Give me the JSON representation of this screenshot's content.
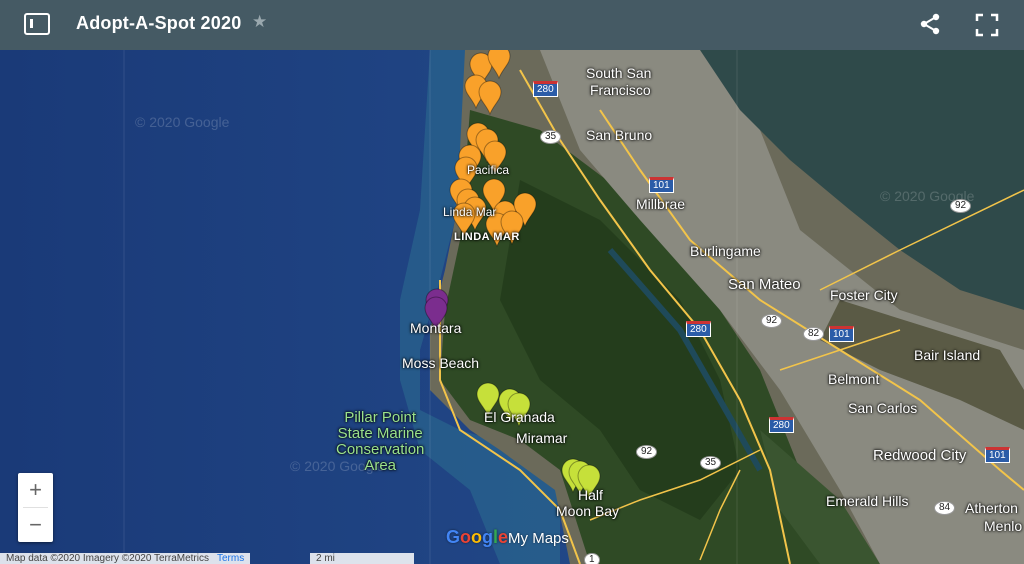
{
  "header": {
    "title": "Adopt-A-Spot 2020",
    "star_icon": "star-icon",
    "share_icon": "share-icon",
    "fullscreen_icon": "fullscreen-icon",
    "menu_icon": "sidebar-toggle-icon"
  },
  "map": {
    "places": [
      {
        "text": "South San",
        "key": "south_san"
      },
      {
        "text": "Francisco",
        "key": "francisco"
      },
      {
        "text": "San Bruno",
        "key": "san_bruno"
      },
      {
        "text": "Millbrae",
        "key": "millbrae"
      },
      {
        "text": "Burlingame",
        "key": "burlingame"
      },
      {
        "text": "San Mateo",
        "key": "san_mateo"
      },
      {
        "text": "Foster City",
        "key": "foster_city"
      },
      {
        "text": "Bair Island",
        "key": "bair_island"
      },
      {
        "text": "Belmont",
        "key": "belmont"
      },
      {
        "text": "San Carlos",
        "key": "san_carlos"
      },
      {
        "text": "Redwood City",
        "key": "redwood_city"
      },
      {
        "text": "Emerald Hills",
        "key": "emerald_hills"
      },
      {
        "text": "Atherton",
        "key": "atherton"
      },
      {
        "text": "Menlo",
        "key": "menlo"
      },
      {
        "text": "Montara",
        "key": "montara"
      },
      {
        "text": "Moss Beach",
        "key": "moss_beach"
      },
      {
        "text": "El Granada",
        "key": "el_granada"
      },
      {
        "text": "Miramar",
        "key": "miramar"
      },
      {
        "text": "Half",
        "key": "half"
      },
      {
        "text": "Moon Bay",
        "key": "moon_bay"
      },
      {
        "text": "Pacifica",
        "key": "pacifica"
      },
      {
        "text": "Linda Mar",
        "key": "linda_mar_small"
      },
      {
        "text": "LINDA MAR",
        "key": "linda_mar"
      }
    ],
    "park": [
      "Pillar Point",
      "State Marine",
      "Conservation",
      "Area"
    ],
    "highways": [
      "280",
      "35",
      "101",
      "92",
      "280",
      "92",
      "82",
      "101",
      "280",
      "92",
      "35",
      "101",
      "84",
      "1"
    ],
    "watermark": "© 2020 Google",
    "marker_colors": {
      "orange": "#f9a12a",
      "purple": "#7b2d8e",
      "yellow": "#c6e03a"
    }
  },
  "zoom": {
    "in": "+",
    "out": "−"
  },
  "attribution": {
    "data": "Map data ©2020 Imagery ©2020 TerraMetrics",
    "terms": "Terms",
    "scale": "2 mi"
  },
  "logo": {
    "g": "G",
    "o1": "o",
    "o2": "o",
    "g2": "g",
    "l": "l",
    "e": "e",
    "mymaps": "My Maps"
  }
}
